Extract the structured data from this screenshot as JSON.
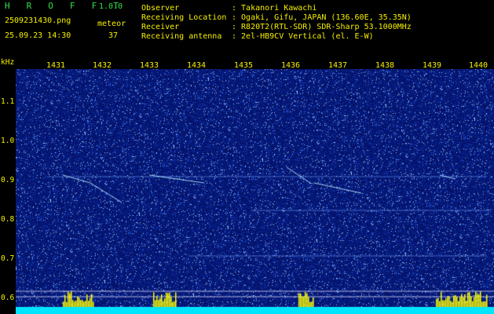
{
  "header": {
    "app_name": "H R O F F T",
    "version": "1.0.0",
    "filename": "2509231430.png",
    "mode_label": "meteor",
    "datetime": "25.09.23 14:30",
    "count": "37",
    "info": [
      {
        "label": "Observer",
        "value": ": Takanori Kawachi"
      },
      {
        "label": "Receiving Location",
        "value": ": Ogaki, Gifu, JAPAN (136.60E, 35.35N)"
      },
      {
        "label": "Receiver",
        "value": ": R820T2(RTL-SDR) SDR-Sharp 53.1000MHz"
      },
      {
        "label": "Receiving antenna",
        "value": ": 2el-HB9CV Vertical (el. E-W)"
      }
    ]
  },
  "y_axis": {
    "unit": "kHz",
    "ticks": [
      "1.1",
      "1.0",
      "0.9",
      "0.8",
      "0.7",
      "0.6"
    ]
  },
  "x_axis": {
    "ticks": [
      "1431",
      "1432",
      "1433",
      "1434",
      "1435",
      "1436",
      "1437",
      "1438",
      "1439",
      "1440"
    ]
  },
  "colors": {
    "background": "#000000",
    "spectrogram": "#0a1a6e",
    "text_yellow": "#f5f000",
    "text_green": "#33e04a",
    "baseline": "#00e5ff"
  }
}
